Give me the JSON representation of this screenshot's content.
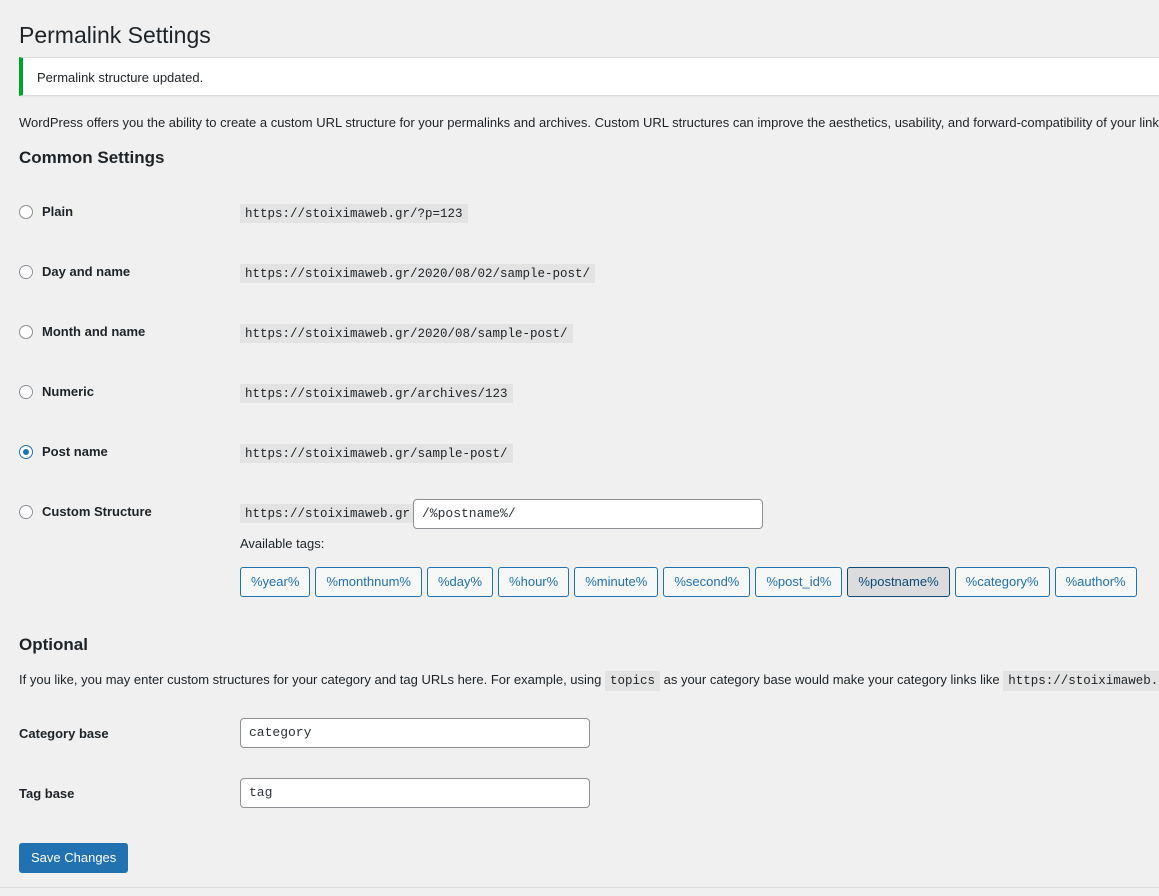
{
  "page": {
    "title": "Permalink Settings",
    "notice": "Permalink structure updated.",
    "intro": "WordPress offers you the ability to create a custom URL structure for your permalinks and archives. Custom URL structures can improve the aesthetics, usability, and forward-compatibility of your links"
  },
  "common": {
    "heading": "Common Settings",
    "options": [
      {
        "label": "Plain",
        "example": "https://stoiximaweb.gr/?p=123",
        "selected": false
      },
      {
        "label": "Day and name",
        "example": "https://stoiximaweb.gr/2020/08/02/sample-post/",
        "selected": false
      },
      {
        "label": "Month and name",
        "example": "https://stoiximaweb.gr/2020/08/sample-post/",
        "selected": false
      },
      {
        "label": "Numeric",
        "example": "https://stoiximaweb.gr/archives/123",
        "selected": false
      },
      {
        "label": "Post name",
        "example": "https://stoiximaweb.gr/sample-post/",
        "selected": true
      },
      {
        "label": "Custom Structure",
        "example": "https://stoiximaweb.gr",
        "selected": false
      }
    ],
    "custom_value": "/%postname%/",
    "available_tags_label": "Available tags:",
    "tags": [
      "%year%",
      "%monthnum%",
      "%day%",
      "%hour%",
      "%minute%",
      "%second%",
      "%post_id%",
      "%postname%",
      "%category%",
      "%author%"
    ],
    "active_tag": "%postname%"
  },
  "optional": {
    "heading": "Optional",
    "desc_before": "If you like, you may enter custom structures for your category and tag URLs here. For example, using ",
    "desc_code": "topics",
    "desc_after": " as your category base would make your category links like ",
    "desc_code2": "https://stoiximaweb.gr/",
    "category_label": "Category base",
    "category_value": "category",
    "tag_label": "Tag base",
    "tag_value": "tag"
  },
  "save_label": "Save Changes"
}
